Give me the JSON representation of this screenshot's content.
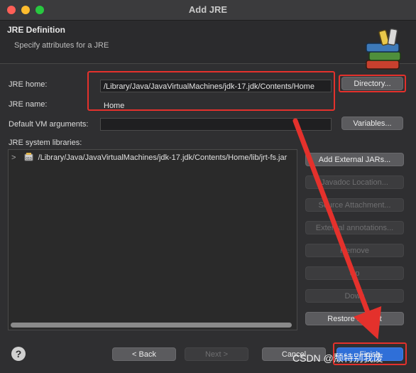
{
  "window": {
    "title": "Add JRE"
  },
  "header": {
    "title": "JRE Definition",
    "subtitle": "Specify attributes for a JRE"
  },
  "form": {
    "jre_home_label": "JRE home:",
    "jre_home_value": "/Library/Java/JavaVirtualMachines/jdk-17.jdk/Contents/Home",
    "jre_name_label": "JRE name:",
    "jre_name_value": "Home",
    "vm_args_label": "Default VM arguments:",
    "vm_args_value": "",
    "libraries_label": "JRE system libraries:"
  },
  "buttons": {
    "directory": "Directory...",
    "variables": "Variables...",
    "add_external_jars": "Add External JARs...",
    "javadoc_location": "Javadoc Location...",
    "source_attachment": "Source Attachment...",
    "external_annotations": "External annotations...",
    "remove": "Remove",
    "up": "Up",
    "down": "Down",
    "restore_default": "Restore Default"
  },
  "libraries": [
    {
      "expander": ">",
      "path": "/Library/Java/JavaVirtualMachines/jdk-17.jdk/Contents/Home/lib/jrt-fs.jar"
    }
  ],
  "footer": {
    "help": "?",
    "back": "< Back",
    "next": "Next >",
    "cancel": "Cancel",
    "finish": "Finish"
  },
  "watermark": "CSDN @颓特别我废",
  "colors": {
    "highlight": "#e4312c",
    "background": "#2f2f31",
    "button": "#5b5b5e"
  }
}
